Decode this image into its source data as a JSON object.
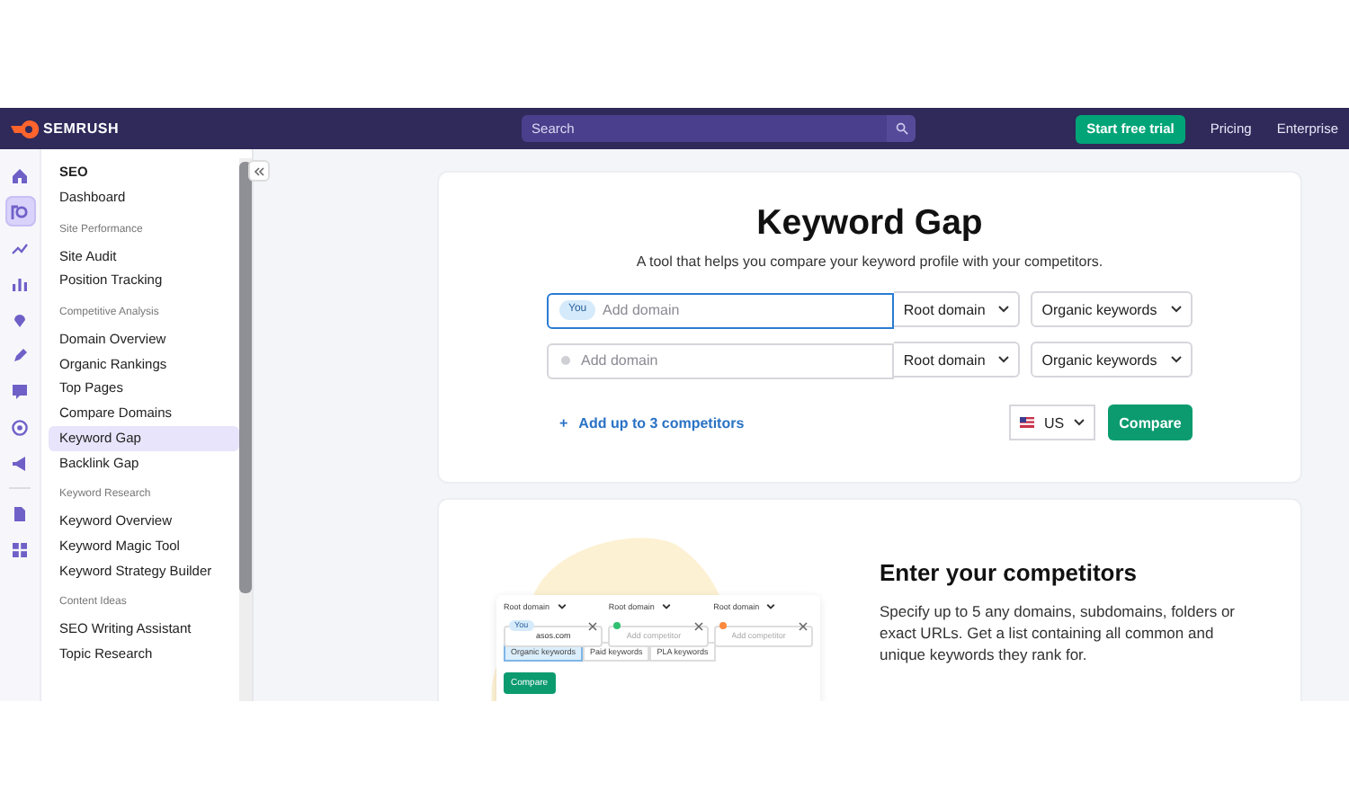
{
  "header": {
    "brand": "SEMRUSH",
    "search": {
      "placeholder": "Search"
    },
    "trial_button": "Start free trial",
    "links": [
      "Pricing",
      "Enterprise"
    ]
  },
  "rail": {
    "items": [
      {
        "kind": "home",
        "selected": false
      },
      {
        "kind": "seo",
        "selected": true
      },
      {
        "kind": "sparkle",
        "selected": false
      },
      {
        "kind": "chart",
        "selected": false
      },
      {
        "kind": "pin",
        "selected": false
      },
      {
        "kind": "pen",
        "selected": false
      },
      {
        "kind": "chat",
        "selected": false
      },
      {
        "kind": "target",
        "selected": false
      },
      {
        "kind": "megaphone",
        "selected": false
      },
      {
        "kind": "divider"
      },
      {
        "kind": "doc",
        "selected": false
      },
      {
        "kind": "grid",
        "selected": false
      }
    ]
  },
  "sidebar": {
    "title": "SEO",
    "sections": [
      {
        "items": [
          {
            "label": "Dashboard",
            "selected": false
          }
        ]
      },
      {
        "heading": "Site Performance",
        "items": [
          {
            "label": "Site Audit",
            "selected": false
          },
          {
            "label": "Position Tracking",
            "selected": false
          }
        ]
      },
      {
        "heading": "Competitive Analysis",
        "items": [
          {
            "label": "Domain Overview",
            "selected": false
          },
          {
            "label": "Organic Rankings",
            "selected": false
          },
          {
            "label": "Top Pages",
            "selected": false
          },
          {
            "label": "Compare Domains",
            "selected": false
          },
          {
            "label": "Keyword Gap",
            "selected": true
          },
          {
            "label": "Backlink Gap",
            "selected": false
          }
        ]
      },
      {
        "heading": "Keyword Research",
        "items": [
          {
            "label": "Keyword Overview",
            "selected": false
          },
          {
            "label": "Keyword Magic Tool",
            "selected": false
          },
          {
            "label": "Keyword Strategy Builder",
            "selected": false
          }
        ]
      },
      {
        "heading": "Content Ideas",
        "items": [
          {
            "label": "SEO Writing Assistant",
            "selected": false
          },
          {
            "label": "Topic Research",
            "selected": false
          }
        ]
      }
    ]
  },
  "tool": {
    "title": "Keyword Gap",
    "subtitle": "A tool that helps you compare your keyword profile with your competitors.",
    "rows": [
      {
        "kind": "you",
        "badge": "You",
        "placeholder": "Add domain",
        "focused": true,
        "scope": "Root domain",
        "type": "Organic keywords"
      },
      {
        "kind": "competitor",
        "placeholder": "Add domain",
        "focused": false,
        "scope": "Root domain",
        "type": "Organic keywords"
      }
    ],
    "add_link": {
      "icon": "+",
      "label": "Add up to 3 competitors"
    },
    "country": "US",
    "compare": "Compare"
  },
  "promo": {
    "illustration": {
      "columns": [
        {
          "scope": "Root domain",
          "kind": "you",
          "badge": "You",
          "value": "asos.com"
        },
        {
          "scope": "Root domain",
          "kind": "competitor",
          "color": "#2fbf71",
          "placeholder": "Add competitor"
        },
        {
          "scope": "Root domain",
          "kind": "competitor",
          "color": "#ff8a3d",
          "placeholder": "Add competitor"
        }
      ],
      "tabs": [
        {
          "label": "Organic keywords",
          "selected": true
        },
        {
          "label": "Paid keywords",
          "selected": false
        },
        {
          "label": "PLA keywords",
          "selected": false
        }
      ],
      "button": "Compare"
    },
    "heading": "Enter your competitors",
    "text": "Specify up to 5 any domains, subdomains, folders or exact URLs. Get a list containing all common and unique keywords they rank for."
  }
}
